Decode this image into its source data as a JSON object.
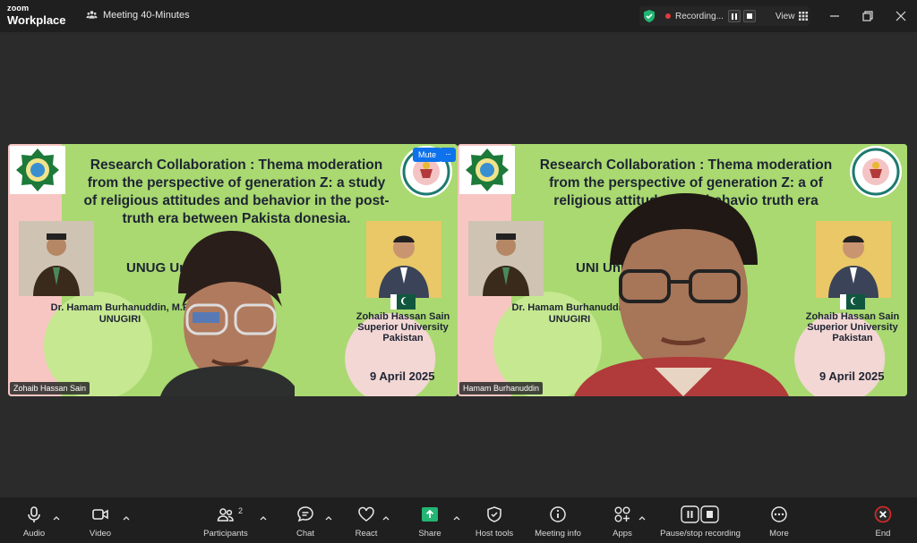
{
  "app": {
    "brand_line1": "zoom",
    "brand_line2": "Workplace"
  },
  "meeting": {
    "title": "Meeting 40-Minutes"
  },
  "recording": {
    "status": "Recording...",
    "view_label": "View"
  },
  "slide": {
    "title": "Research Collaboration : Thema moderation from the perspective of generation Z: a study of religious attitudes and behavior in the post-truth era between Pakistan and Indonesia.",
    "title_left": "Research Collaboration : Thema moderation from the perspective of generation Z: a study of religious attitudes and behavior in the post-truth era between Pakista         donesia.",
    "title_right": "Research Collaboration : Thema moderation from the perspective of generation Z: a         of religious attitudes and behavio          truth era between P                   nesia.",
    "uni_left": "UNUG                University",
    "uni_right": "UNI                              University",
    "presenter_left": "Dr. Hamam Burhanuddin, M.P",
    "presenter_left_org": "UNUGIRI",
    "presenter_left_right": "Dr. Hamam Burhanuddin",
    "presenter_right_name": "Zohaib Hassan Sain",
    "presenter_right_org": "Superior University",
    "presenter_right_country": "Pakistan",
    "date": "9 April 2025"
  },
  "tiles": [
    {
      "name": "Zohaib Hassan Sain"
    },
    {
      "name": "Hamam Burhanuddin"
    }
  ],
  "tile_controls": {
    "mute": "Mute",
    "more": "···"
  },
  "toolbar": {
    "audio": "Audio",
    "video": "Video",
    "participants": "Participants",
    "participant_count": "2",
    "chat": "Chat",
    "react": "React",
    "share": "Share",
    "host_tools": "Host tools",
    "meeting_info": "Meeting info",
    "apps": "Apps",
    "pause_stop": "Pause/stop recording",
    "more": "More",
    "end": "End"
  },
  "colors": {
    "accent": "#0e72ed",
    "share": "#22b573",
    "end": "#e02828",
    "slide_bg": "#a9d970"
  }
}
